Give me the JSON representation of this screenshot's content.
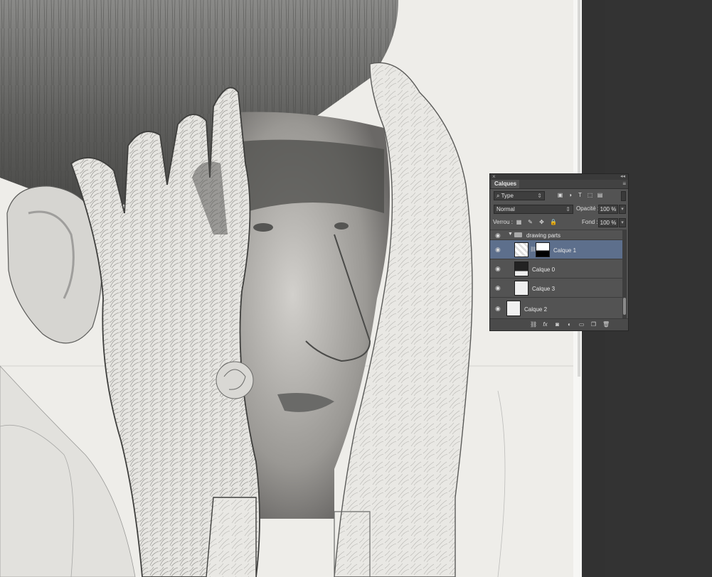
{
  "panel": {
    "tab_label": "Calques",
    "filter_type": "Type",
    "filter_icons": [
      {
        "name": "image-filter-icon",
        "glyph": "▣"
      },
      {
        "name": "adjustment-filter-icon",
        "glyph": "◑"
      },
      {
        "name": "text-filter-icon",
        "glyph": "T"
      },
      {
        "name": "shape-filter-icon",
        "glyph": "⬚"
      },
      {
        "name": "smart-object-filter-icon",
        "glyph": "▤"
      }
    ],
    "blend_mode": "Normal",
    "opacity_label": "Opacité :",
    "opacity_value": "100 %",
    "lock_label": "Verrou :",
    "fill_label": "Fond :",
    "fill_value": "100 %",
    "layers": [
      {
        "name": "drawing parts",
        "type": "group"
      },
      {
        "name": "Calque 1",
        "selected": true
      },
      {
        "name": "Calque 0"
      },
      {
        "name": "Calque 3"
      },
      {
        "name": "Calque 2"
      }
    ],
    "bottom_icons": [
      {
        "name": "link-layers-icon",
        "glyph": "⛓"
      },
      {
        "name": "fx-icon",
        "glyph": "fx"
      },
      {
        "name": "add-mask-icon",
        "glyph": "◙"
      },
      {
        "name": "adjustment-layer-icon",
        "glyph": "◐"
      },
      {
        "name": "new-group-icon",
        "glyph": "▭"
      },
      {
        "name": "new-layer-icon",
        "glyph": "❐"
      },
      {
        "name": "delete-layer-icon",
        "glyph": "🗑"
      }
    ]
  }
}
